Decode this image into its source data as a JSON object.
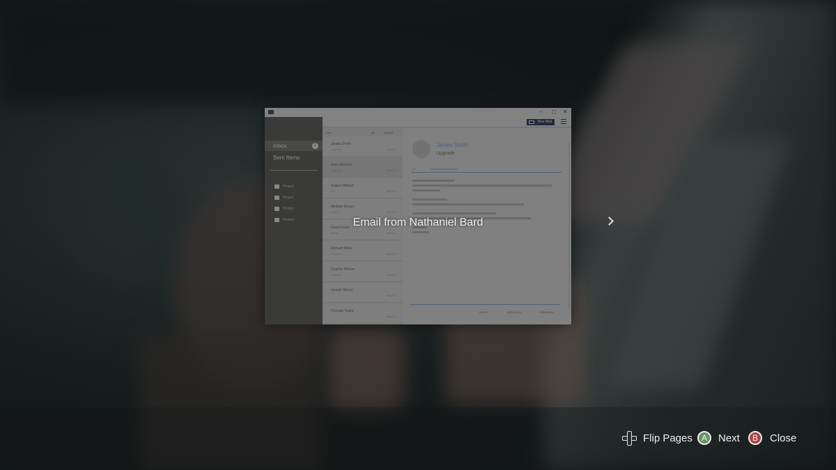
{
  "document": {
    "title": "Email from Nathaniel Bard"
  },
  "email_window": {
    "window_controls": [
      "–",
      "◻",
      "✕"
    ],
    "new_mail_label": "New Mail",
    "folders": [
      {
        "label": "Inbox",
        "count": "1"
      },
      {
        "label": "Sent Items"
      }
    ],
    "project_folders": [
      "Project",
      "Project",
      "Project",
      "Project"
    ],
    "list_header": [
      "Sort",
      "All",
      "Unread"
    ],
    "messages": [
      {
        "from": "James Smith",
        "subject": "Upgrade",
        "date": "Nov 14"
      },
      {
        "from": "Alex Johnson",
        "subject": "Upgrade",
        "date": "Nov 14"
      },
      {
        "from": "Robert William",
        "subject": "Re:",
        "date": "Nov 14"
      },
      {
        "from": "Michael Brown",
        "subject": "Inquiry",
        "date": "Nov 14"
      },
      {
        "from": "David Davis",
        "subject": "News",
        "date": "Nov 14"
      },
      {
        "from": "Richard Miller",
        "subject": "Upgrade",
        "date": "Nov 14"
      },
      {
        "from": "Charles Wilson",
        "subject": "Upgrade",
        "date": "Nov 14"
      },
      {
        "from": "Joseph Moore",
        "subject": "",
        "date": "Nov 14"
      },
      {
        "from": "Thomas Taylor",
        "subject": "",
        "date": "Nov 14"
      }
    ],
    "reader": {
      "from": "James Smith",
      "subject": "Upgrade",
      "to_label": "To",
      "actions": [
        "REPLY",
        "REPLY ALL",
        "FORWARD"
      ]
    }
  },
  "navigation": {
    "next_arrow_icon": "chevron-right-icon"
  },
  "button_prompts": [
    {
      "icon": "dpad-icon",
      "label": "Flip Pages"
    },
    {
      "icon": "a-button-icon",
      "glyph": "A",
      "label": "Next",
      "color": "#6a8f66"
    },
    {
      "icon": "b-button-icon",
      "glyph": "B",
      "label": "Close",
      "color": "#a8454a"
    }
  ]
}
